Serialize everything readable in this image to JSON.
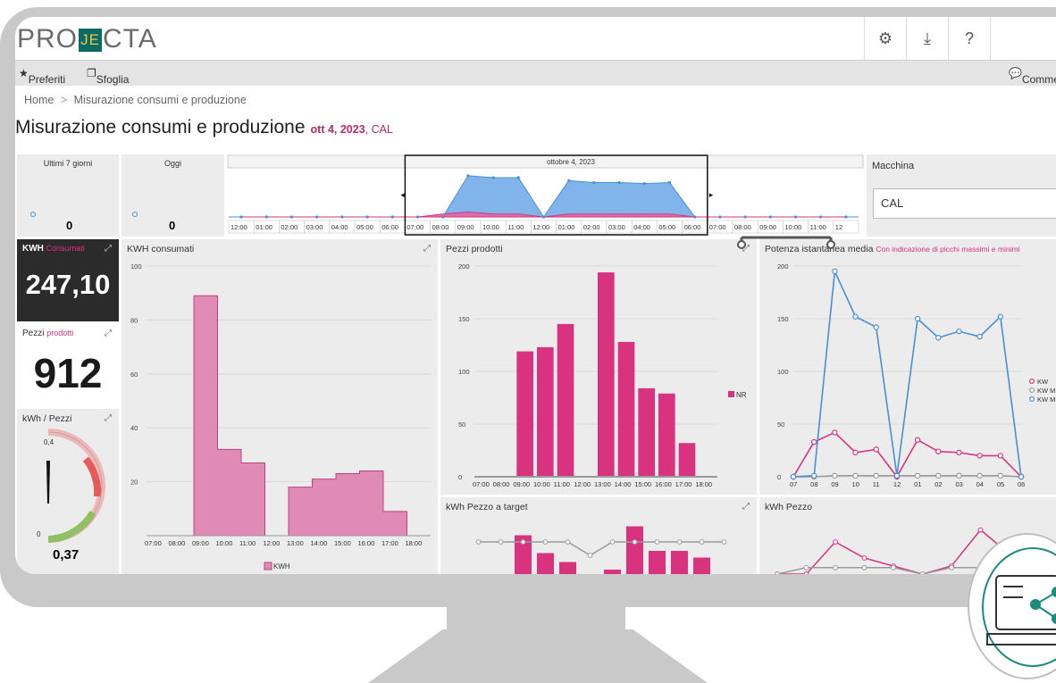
{
  "app": {
    "logo_left": "PRO",
    "logo_mark": "JE",
    "logo_right": "CTA"
  },
  "toolbar": {
    "settings_icon": "gear-icon",
    "download_icon": "download-icon",
    "help_label": "?"
  },
  "menu": {
    "preferiti": "Preferiti",
    "sfoglia": "Sfoglia",
    "comments": "Comme"
  },
  "breadcrumb": {
    "home": "Home",
    "sep": ">",
    "current": "Misurazione consumi e produzione"
  },
  "page": {
    "title": "Misurazione consumi e produzione",
    "date": "ott 4, 2023",
    "machine_suffix": ", CAL"
  },
  "summary": {
    "last7_label": "Ultimi 7 giorni",
    "last7_value": "0",
    "today_label": "Oggi",
    "today_value": "0"
  },
  "timeline": {
    "date_label": "ottobre 4, 2023",
    "hours": [
      "12:00",
      "01:00",
      "02:00",
      "03:00",
      "04:00",
      "05:00",
      "06:00",
      "07:00",
      "08:00",
      "09:00",
      "10:00",
      "11:00",
      "12:00",
      "01:00",
      "02:00",
      "03:00",
      "04:00",
      "05:00",
      "06:00",
      "07:00",
      "08:00",
      "09:00",
      "10:00",
      "11:00",
      "12"
    ],
    "blue": [
      0,
      0,
      0,
      0,
      0,
      0,
      0,
      0,
      0,
      42,
      40,
      40,
      0,
      37,
      35,
      35,
      34,
      35,
      0,
      0,
      0,
      0,
      0,
      0,
      0
    ],
    "pink": [
      0,
      0,
      0,
      0,
      0,
      0,
      0,
      0,
      3,
      5,
      3,
      3,
      0,
      3,
      3,
      3,
      3,
      3,
      0,
      0,
      0,
      0,
      0,
      0,
      0
    ]
  },
  "machine": {
    "label": "Macchina",
    "value": "CAL"
  },
  "kpi_kwh": {
    "label": "KWH",
    "sub": "Consumati",
    "value": "247,10"
  },
  "kpi_pezzi": {
    "label": "Pezzi",
    "sub": "prodotti",
    "value": "912"
  },
  "kpi_ratio": {
    "label": "kWh / Pezzi",
    "value": "0,37",
    "gauge_top": "0,4",
    "gauge_bottom": "0",
    "gauge_fraction": 0.95
  },
  "colors": {
    "accent": "#b8296e",
    "bar_pink": "#d9337f",
    "area_pink": "#e08bb6",
    "line_blue": "#4a8fd6",
    "gray": "#9a9a9a"
  },
  "chart_data": [
    {
      "type": "area",
      "title": "KWH consumati",
      "categories": [
        "07:00",
        "08:00",
        "09:00",
        "10:00",
        "11:00",
        "12:00",
        "13:00",
        "14:00",
        "15:00",
        "16:00",
        "17:00",
        "18:00"
      ],
      "series": [
        {
          "name": "KWH",
          "values": [
            0,
            0,
            89,
            32,
            27,
            0,
            18,
            21,
            23,
            24,
            9,
            0
          ]
        }
      ],
      "yticks": [
        100,
        80,
        60,
        40,
        20
      ],
      "ylim": [
        0,
        100
      ]
    },
    {
      "type": "bar",
      "title": "Pezzi prodotti",
      "categories": [
        "07:00",
        "08:00",
        "09:00",
        "10:00",
        "11:00",
        "12:00",
        "13:00",
        "14:00",
        "15:00",
        "16:00",
        "17:00",
        "18:00"
      ],
      "series": [
        {
          "name": "NR",
          "values": [
            0,
            0,
            119,
            123,
            145,
            0,
            194,
            128,
            84,
            79,
            32,
            0
          ]
        }
      ],
      "yticks": [
        200,
        150,
        100,
        50,
        0
      ],
      "ylim": [
        0,
        200
      ]
    },
    {
      "type": "line",
      "title": "Potenza istantanea media",
      "subtitle": "Con indicazione di picchi massimi e minimi",
      "categories": [
        "07",
        "08",
        "09",
        "10",
        "11",
        "12",
        "01",
        "02",
        "03",
        "04",
        "05",
        "06"
      ],
      "series": [
        {
          "name": "KW",
          "values": [
            0,
            33,
            42,
            23,
            26,
            0,
            35,
            24,
            23,
            20,
            20,
            0
          ]
        },
        {
          "name": "KW M",
          "values": [
            0,
            0,
            1,
            1,
            1,
            1,
            1,
            1,
            1,
            1,
            1,
            0
          ]
        },
        {
          "name": "KW M",
          "values": [
            0,
            1,
            195,
            152,
            142,
            1,
            150,
            132,
            138,
            133,
            152,
            0
          ]
        }
      ],
      "yticks": [
        200,
        150,
        100,
        50,
        0
      ],
      "ylim": [
        0,
        200
      ]
    },
    {
      "type": "bar",
      "title": "kWh Pezzo a target",
      "series": [
        {
          "values": [
            0,
            0,
            0.95,
            0.55,
            0.35,
            0,
            0.18,
            1.15,
            0.6,
            0.6,
            0.45,
            0
          ]
        },
        {
          "values": [
            0.3,
            0.3,
            0.3,
            0.3,
            0.3,
            0,
            0.3,
            0.3,
            0.3,
            0.3,
            0.3,
            0.3
          ]
        }
      ]
    },
    {
      "type": "line",
      "title": "kWh Pezzo",
      "series": [
        {
          "values": [
            0,
            0,
            0.4,
            0.2,
            0.1,
            0,
            0.1,
            0.55,
            0.25
          ]
        },
        {
          "values": [
            0,
            0.08,
            0.08,
            0.08,
            0.08,
            0,
            0.08,
            0.08,
            0.08
          ]
        }
      ]
    }
  ]
}
